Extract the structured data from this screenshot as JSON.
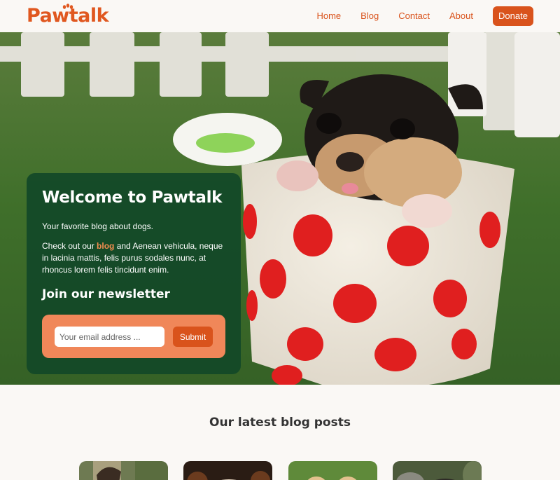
{
  "header": {
    "logo_text": "Pawtalk",
    "nav": [
      {
        "label": "Home"
      },
      {
        "label": "Blog"
      },
      {
        "label": "Contact"
      },
      {
        "label": "About"
      }
    ],
    "donate_label": "Donate"
  },
  "hero": {
    "title": "Welcome to Pawtalk",
    "subtitle": "Your favorite blog about dogs.",
    "body_prefix": "Check out our ",
    "body_link": "blog",
    "body_suffix": " and Aenean vehicula, neque in lacinia mattis, felis purus sodales nunc, at rhoncus lorem felis tincidunt enim.",
    "newsletter_title": "Join our newsletter",
    "email_placeholder": "Your email address ...",
    "submit_label": "Submit"
  },
  "latest": {
    "title": "Our latest blog posts"
  },
  "colors": {
    "accent": "#d9531c",
    "card_bg": "#124828",
    "newsletter_bg": "#f08759"
  },
  "icons": [
    "paw-icon"
  ]
}
